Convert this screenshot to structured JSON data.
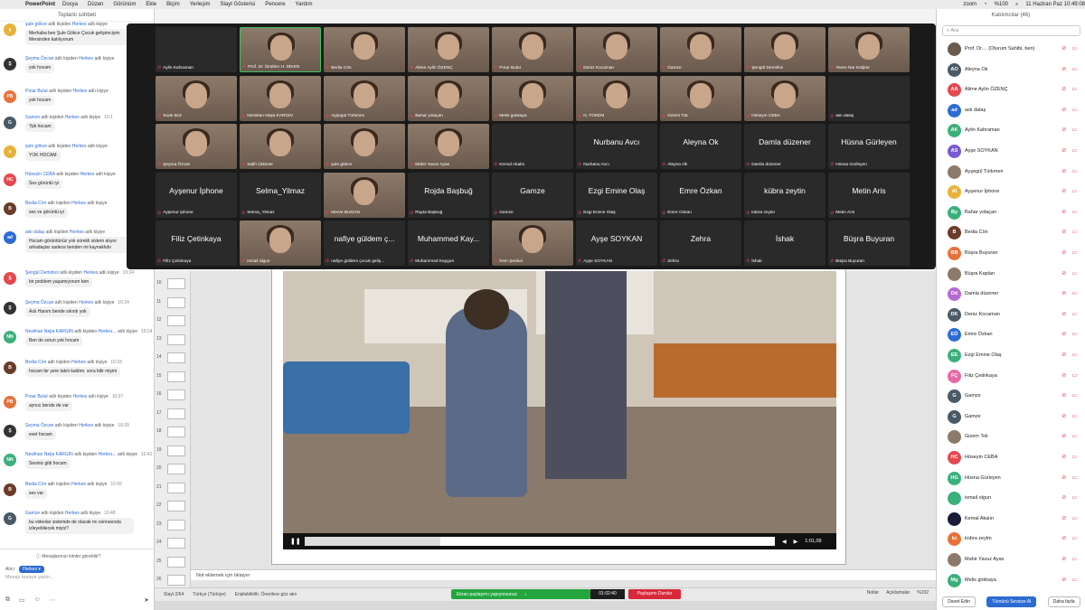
{
  "menubar": {
    "app": "PowerPoint",
    "items": [
      "Dosya",
      "Düzen",
      "Görünüm",
      "Ekle",
      "Biçim",
      "Yerleşim",
      "Slayt Gösterisi",
      "Pencere",
      "Yardım"
    ],
    "zoom_label": "zoom",
    "battery": "%100",
    "datetime": "11 Haziran Paz 10:49:08"
  },
  "chat": {
    "title": "Toplantı sohbeti",
    "to_label": "Herkes",
    "messages": [
      {
        "initials": "ş",
        "color": "#e8b23a",
        "sender": "şule gökce",
        "to": "Herkes",
        "time": "",
        "text": "Merhaba ben Şule Gökce Çocuk gelişimciyim Mersinden katılıyorum"
      },
      {
        "initials": "Ş",
        "color": "#ffffff",
        "sender": "Şeyma Özcan",
        "to": "Herkes",
        "time": "",
        "text": "yok hocam"
      },
      {
        "initials": "PB",
        "color": "#e8713a",
        "sender": "Pınar Bulut",
        "to": "Herkes",
        "time": "",
        "text": "yok hocam"
      },
      {
        "initials": "G",
        "color": "#4a5a66",
        "sender": "Gamze",
        "to": "Herkes",
        "time": "10:1",
        "text": "Ypk hocam"
      },
      {
        "initials": "ş",
        "color": "#e8b23a",
        "sender": "şule gökce",
        "to": "Herkes",
        "time": "",
        "text": "YOK HOCAM"
      },
      {
        "initials": "HC",
        "color": "#e5484d",
        "sender": "Hüseyin CEBA",
        "to": "Herkes",
        "time": "",
        "text": "Ses görüntü iyi"
      },
      {
        "initials": "B",
        "color": "#6b3b2a",
        "sender": "Bedia Cön",
        "to": "Herkes",
        "time": "",
        "text": "ses ve görüntü iyi"
      },
      {
        "initials": "ad",
        "color": "#2d6bd3",
        "sender": "aslı dalaş",
        "to": "Herkes",
        "time": "",
        "text": "Hocam görüntünüz yok sürekli sistem atıyor arkadaşlar sadece benden mi kaynaklıdır"
      },
      {
        "initials": "Ş",
        "color": "#e5484d",
        "sender": "Şengül Demirkol",
        "to": "Herkes",
        "time": "10:24",
        "text": "bir problem yaşamıyorum ben"
      },
      {
        "initials": "Ş",
        "color": "#ffffff",
        "sender": "Şeyma Özcan",
        "to": "Herkes",
        "time": "10:24",
        "text": "Aslı Hanım bende sıkıntı yok"
      },
      {
        "initials": "NN",
        "color": "#3ab07a",
        "sender": "Neslihan Nejla KARGIN",
        "to": "Herkes...",
        "time": "10:24",
        "text": "Ben de sorun yok hocam"
      },
      {
        "initials": "B",
        "color": "#6b3b2a",
        "sender": "Bedia Cön",
        "to": "Herkes",
        "time": "10:33",
        "text": "hocam bir yere takılı kaldım. sora bilir miyim"
      },
      {
        "initials": "PB",
        "color": "#e8713a",
        "sender": "Pınar Bulut",
        "to": "Herkes",
        "time": "10:37",
        "text": "aynısı bende de var"
      },
      {
        "initials": "Ş",
        "color": "#ffffff",
        "sender": "Şeyma Özcan",
        "to": "Herkes",
        "time": "10:39",
        "text": "evet hocam"
      },
      {
        "initials": "NN",
        "color": "#3ab07a",
        "sender": "Neslihan Nejla KARGIN",
        "to": "Herkes...",
        "time": "10:42",
        "text": "Sesiniz gitti hocam"
      },
      {
        "initials": "B",
        "color": "#6b3b2a",
        "sender": "Bedia Cön",
        "to": "Herkes",
        "time": "10:42",
        "text": "ses var"
      },
      {
        "initials": "G",
        "color": "#4a5a66",
        "sender": "Gamze",
        "to": "Herkes",
        "time": "10:48",
        "text": "bu videolar sistemde de olacak mı sonrasında izleyebilecek miyiz?"
      }
    ],
    "from_word": "adlı kişiden",
    "to_word": "adlı kişiye",
    "who_can_see": "Mesajlarınızı kimler görebilir?",
    "to_prefix": "Alıcı:",
    "input_placeholder": "Mesajı buraya yazın..."
  },
  "ppt": {
    "slide_numbers": [
      "10",
      "11",
      "12",
      "13",
      "14",
      "15",
      "16",
      "17",
      "18",
      "19",
      "20",
      "21",
      "22",
      "23",
      "24",
      "25",
      "26"
    ],
    "video_time": "1:01,09",
    "notes_placeholder": "Not eklemek için tıklayın",
    "status": {
      "slide": "Slayt 2/64",
      "language": "Türkçe (Türkiye)",
      "accessibility": "Erişilebilirlik: Önerilere göz atın",
      "notes": "Notlar",
      "comments": "Açıklamalar",
      "zoom": "%192"
    },
    "share": {
      "label": "Ekran paylaşımı yapıyorsunuz",
      "timer": "01:02:40",
      "stop": "Paylaşımı Durdur"
    }
  },
  "gallery": {
    "tiles": [
      {
        "name": "Aylin Kahraman",
        "big": "",
        "photo": false,
        "active": false
      },
      {
        "name": "Prof. Dr. İbrahim H. DİKEN",
        "big": "",
        "photo": true,
        "active": true
      },
      {
        "name": "Bedia Cön",
        "big": "",
        "photo": true,
        "active": false
      },
      {
        "name": "Alime Aylin ÖZENÇ",
        "big": "",
        "photo": true,
        "active": false
      },
      {
        "name": "Pınar Bulut",
        "big": "",
        "photo": true,
        "active": false
      },
      {
        "name": "Deniz Kocaman",
        "big": "",
        "photo": true,
        "active": false
      },
      {
        "name": "Gamze",
        "big": "",
        "photo": true,
        "active": false
      },
      {
        "name": "Şengül Demirkol",
        "big": "",
        "photo": true,
        "active": false
      },
      {
        "name": "Yaren Nur Köşker",
        "big": "",
        "photo": true,
        "active": false
      },
      {
        "name": "Sude Boz",
        "big": "",
        "photo": true,
        "active": false
      },
      {
        "name": "Neslihan Nejla KARGIN",
        "big": "",
        "photo": true,
        "active": false
      },
      {
        "name": "Ayşegül Türkmen",
        "big": "",
        "photo": true,
        "active": false
      },
      {
        "name": "Bahar yolaçan",
        "big": "",
        "photo": true,
        "active": false
      },
      {
        "name": "Melis gokkaya",
        "big": "",
        "photo": true,
        "active": false
      },
      {
        "name": "N. TOKEM",
        "big": "",
        "photo": true,
        "active": false
      },
      {
        "name": "Gizem Tok",
        "big": "",
        "photo": true,
        "active": false
      },
      {
        "name": "Hüseyin CEBA",
        "big": "",
        "photo": true,
        "active": false
      },
      {
        "name": "aslı dalaş",
        "big": "",
        "photo": false,
        "active": false
      },
      {
        "name": "Şeyma Özcan",
        "big": "",
        "photo": true,
        "active": false
      },
      {
        "name": "Salih Üstüner",
        "big": "",
        "photo": true,
        "active": false
      },
      {
        "name": "şule gökce",
        "big": "",
        "photo": true,
        "active": false
      },
      {
        "name": "Mahir Yavuz Ayas",
        "big": "",
        "photo": true,
        "active": false
      },
      {
        "name": "Kemal Akalın",
        "big": "",
        "photo": false,
        "active": false
      },
      {
        "name": "Nurbanu Avcı",
        "big": "Nurbanu Avcı",
        "photo": false,
        "active": false
      },
      {
        "name": "Aleyna Ok",
        "big": "Aleyna Ok",
        "photo": false,
        "active": false
      },
      {
        "name": "Damla düzener",
        "big": "Damla düzener",
        "photo": false,
        "active": false
      },
      {
        "name": "Hüsna Gürleyen",
        "big": "Hüsna Gürleyen",
        "photo": false,
        "active": false
      },
      {
        "name": "Ayşenur İphone",
        "big": "Ayşenur İphone",
        "photo": false,
        "active": false
      },
      {
        "name": "Selma_Yilmaz",
        "big": "Selma_Yilmaz",
        "photo": false,
        "active": false
      },
      {
        "name": "Merve BUĞAN",
        "big": "",
        "photo": true,
        "active": false
      },
      {
        "name": "Rojda Başbuğ",
        "big": "Rojda Başbuğ",
        "photo": false,
        "active": false
      },
      {
        "name": "Gamze",
        "big": "Gamze",
        "photo": false,
        "active": false
      },
      {
        "name": "Ezgi Emine Olaş",
        "big": "Ezgi Emine Olaş",
        "photo": false,
        "active": false
      },
      {
        "name": "Emre Özkan",
        "big": "Emre Özkan",
        "photo": false,
        "active": false
      },
      {
        "name": "kübra zeytin",
        "big": "kübra zeytin",
        "photo": false,
        "active": false
      },
      {
        "name": "Metin Aris",
        "big": "Metin Aris",
        "photo": false,
        "active": false
      },
      {
        "name": "Filiz Çetinkaya",
        "big": "Filiz Çetinkaya",
        "photo": false,
        "active": false
      },
      {
        "name": "ismail olgun",
        "big": "",
        "photo": true,
        "active": false
      },
      {
        "name": "nafiye güldem çocuk geliş...",
        "big": "nafiye güldem ç...",
        "photo": false,
        "active": false
      },
      {
        "name": "Muhammed Kaygun",
        "big": "Muhammed Kay...",
        "photo": false,
        "active": false
      },
      {
        "name": "İrem Şenkal",
        "big": "",
        "photo": true,
        "active": false
      },
      {
        "name": "Ayşe SOYKAN",
        "big": "Ayşe SOYKAN",
        "photo": false,
        "active": false
      },
      {
        "name": "Zehra",
        "big": "Zehra",
        "photo": false,
        "active": false
      },
      {
        "name": "İshak",
        "big": "İshak",
        "photo": false,
        "active": false
      },
      {
        "name": "Büşra Buyuran",
        "big": "Büşra Buyuran",
        "photo": false,
        "active": false
      }
    ]
  },
  "participants": {
    "title": "Katılımcılar (46)",
    "search_placeholder": "Ara",
    "host_suffix": "(Oturum Sahibi, ben)",
    "list": [
      {
        "initials": "",
        "name": "Prof. Dr....",
        "color": "#6a5a4e"
      },
      {
        "initials": "AO",
        "name": "Aleyna Ok",
        "color": "#4a5a66"
      },
      {
        "initials": "AA",
        "name": "Alime Aylin ÖZENÇ",
        "color": "#e5484d"
      },
      {
        "initials": "ad",
        "name": "aslı dalaş",
        "color": "#2d6bd3"
      },
      {
        "initials": "AK",
        "name": "Aylin Kahraman",
        "color": "#3ab07a"
      },
      {
        "initials": "AS",
        "name": "Ayşe SOYKAN",
        "color": "#7a5ad3"
      },
      {
        "initials": "",
        "name": "Ayşegül Türkmen",
        "color": "#8d7a6a"
      },
      {
        "initials": "Aİ",
        "name": "Ayşenur İphone",
        "color": "#e8b23a"
      },
      {
        "initials": "By",
        "name": "Bahar yolaçan",
        "color": "#3ab07a"
      },
      {
        "initials": "B",
        "name": "Bedia Cön",
        "color": "#6b3b2a"
      },
      {
        "initials": "BB",
        "name": "Büşra Buyuran",
        "color": "#e8713a"
      },
      {
        "initials": "",
        "name": "Büşra Kaplan",
        "color": "#8d7a6a"
      },
      {
        "initials": "Dd",
        "name": "Damla düzener",
        "color": "#b56ad3"
      },
      {
        "initials": "DK",
        "name": "Deniz Kocaman",
        "color": "#4a5a66"
      },
      {
        "initials": "EÖ",
        "name": "Emre Özkan",
        "color": "#2d6bd3"
      },
      {
        "initials": "EE",
        "name": "Ezgi Emine Olaş",
        "color": "#3ab07a"
      },
      {
        "initials": "FÇ",
        "name": "Filiz Çetinkaya",
        "color": "#e56aa8"
      },
      {
        "initials": "G",
        "name": "Gamze",
        "color": "#4a5a66"
      },
      {
        "initials": "G",
        "name": "Gamze",
        "color": "#4a5a66"
      },
      {
        "initials": "",
        "name": "Gizem Tok",
        "color": "#8d7a6a"
      },
      {
        "initials": "HC",
        "name": "Hüseyin CEBA",
        "color": "#e5484d"
      },
      {
        "initials": "HG",
        "name": "Hüsna Gürleyen",
        "color": "#3ab07a"
      },
      {
        "initials": "",
        "name": "ismail olgun",
        "color": "#3ab07a"
      },
      {
        "initials": "",
        "name": "Kemal Akalın",
        "color": "#1a1a3a"
      },
      {
        "initials": "kz",
        "name": "kübra zeytin",
        "color": "#e8713a"
      },
      {
        "initials": "",
        "name": "Mahir Yavuz Ayas",
        "color": "#8d7a6a"
      },
      {
        "initials": "Mg",
        "name": "Melis gokkaya",
        "color": "#3ab07a"
      }
    ],
    "invite": "Davet Edin",
    "mute_all": "Tümünü Sessize Al",
    "more": "Daha fazla"
  }
}
